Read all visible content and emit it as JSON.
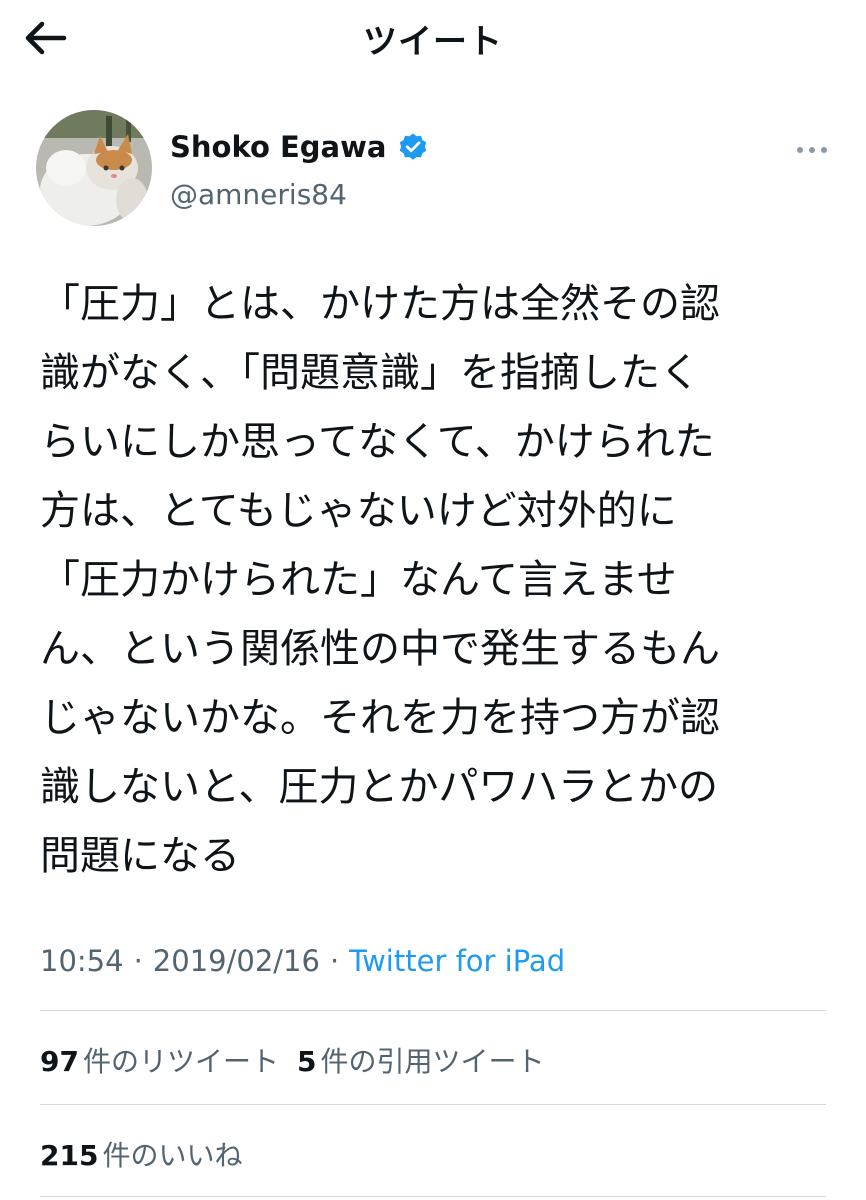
{
  "header": {
    "title": "ツイート",
    "back_icon": "arrow-left-icon"
  },
  "author": {
    "display_name": "Shoko Egawa",
    "handle": "@amneris84",
    "verified": true,
    "verified_color": "#1d9bf0"
  },
  "tweet": {
    "lines": [
      "「圧力」とは、かけた方は全然その認",
      "識がなく、「問題意識」を指摘したく",
      "らいにしか思ってなくて、かけられた",
      "方は、とてもじゃないけど対外的に",
      "「圧力かけられた」なんて言えませ",
      "ん、という関係性の中で発生するもん",
      "じゃないかな。それを力を持つ方が認",
      "識しないと、圧力とかパワハラとかの",
      "問題になる"
    ],
    "time": "10:54",
    "separator": "·",
    "date": "2019/02/16",
    "source": "Twitter for iPad"
  },
  "stats": {
    "retweets": {
      "count": "97",
      "label": "件のリツイート"
    },
    "quotes": {
      "count": "5",
      "label": "件の引用ツイート"
    },
    "likes": {
      "count": "215",
      "label": "件のいいね"
    }
  },
  "colors": {
    "text": "#0f1419",
    "secondary": "#536471",
    "link": "#1d9bf0",
    "divider": "#cfd9de"
  }
}
